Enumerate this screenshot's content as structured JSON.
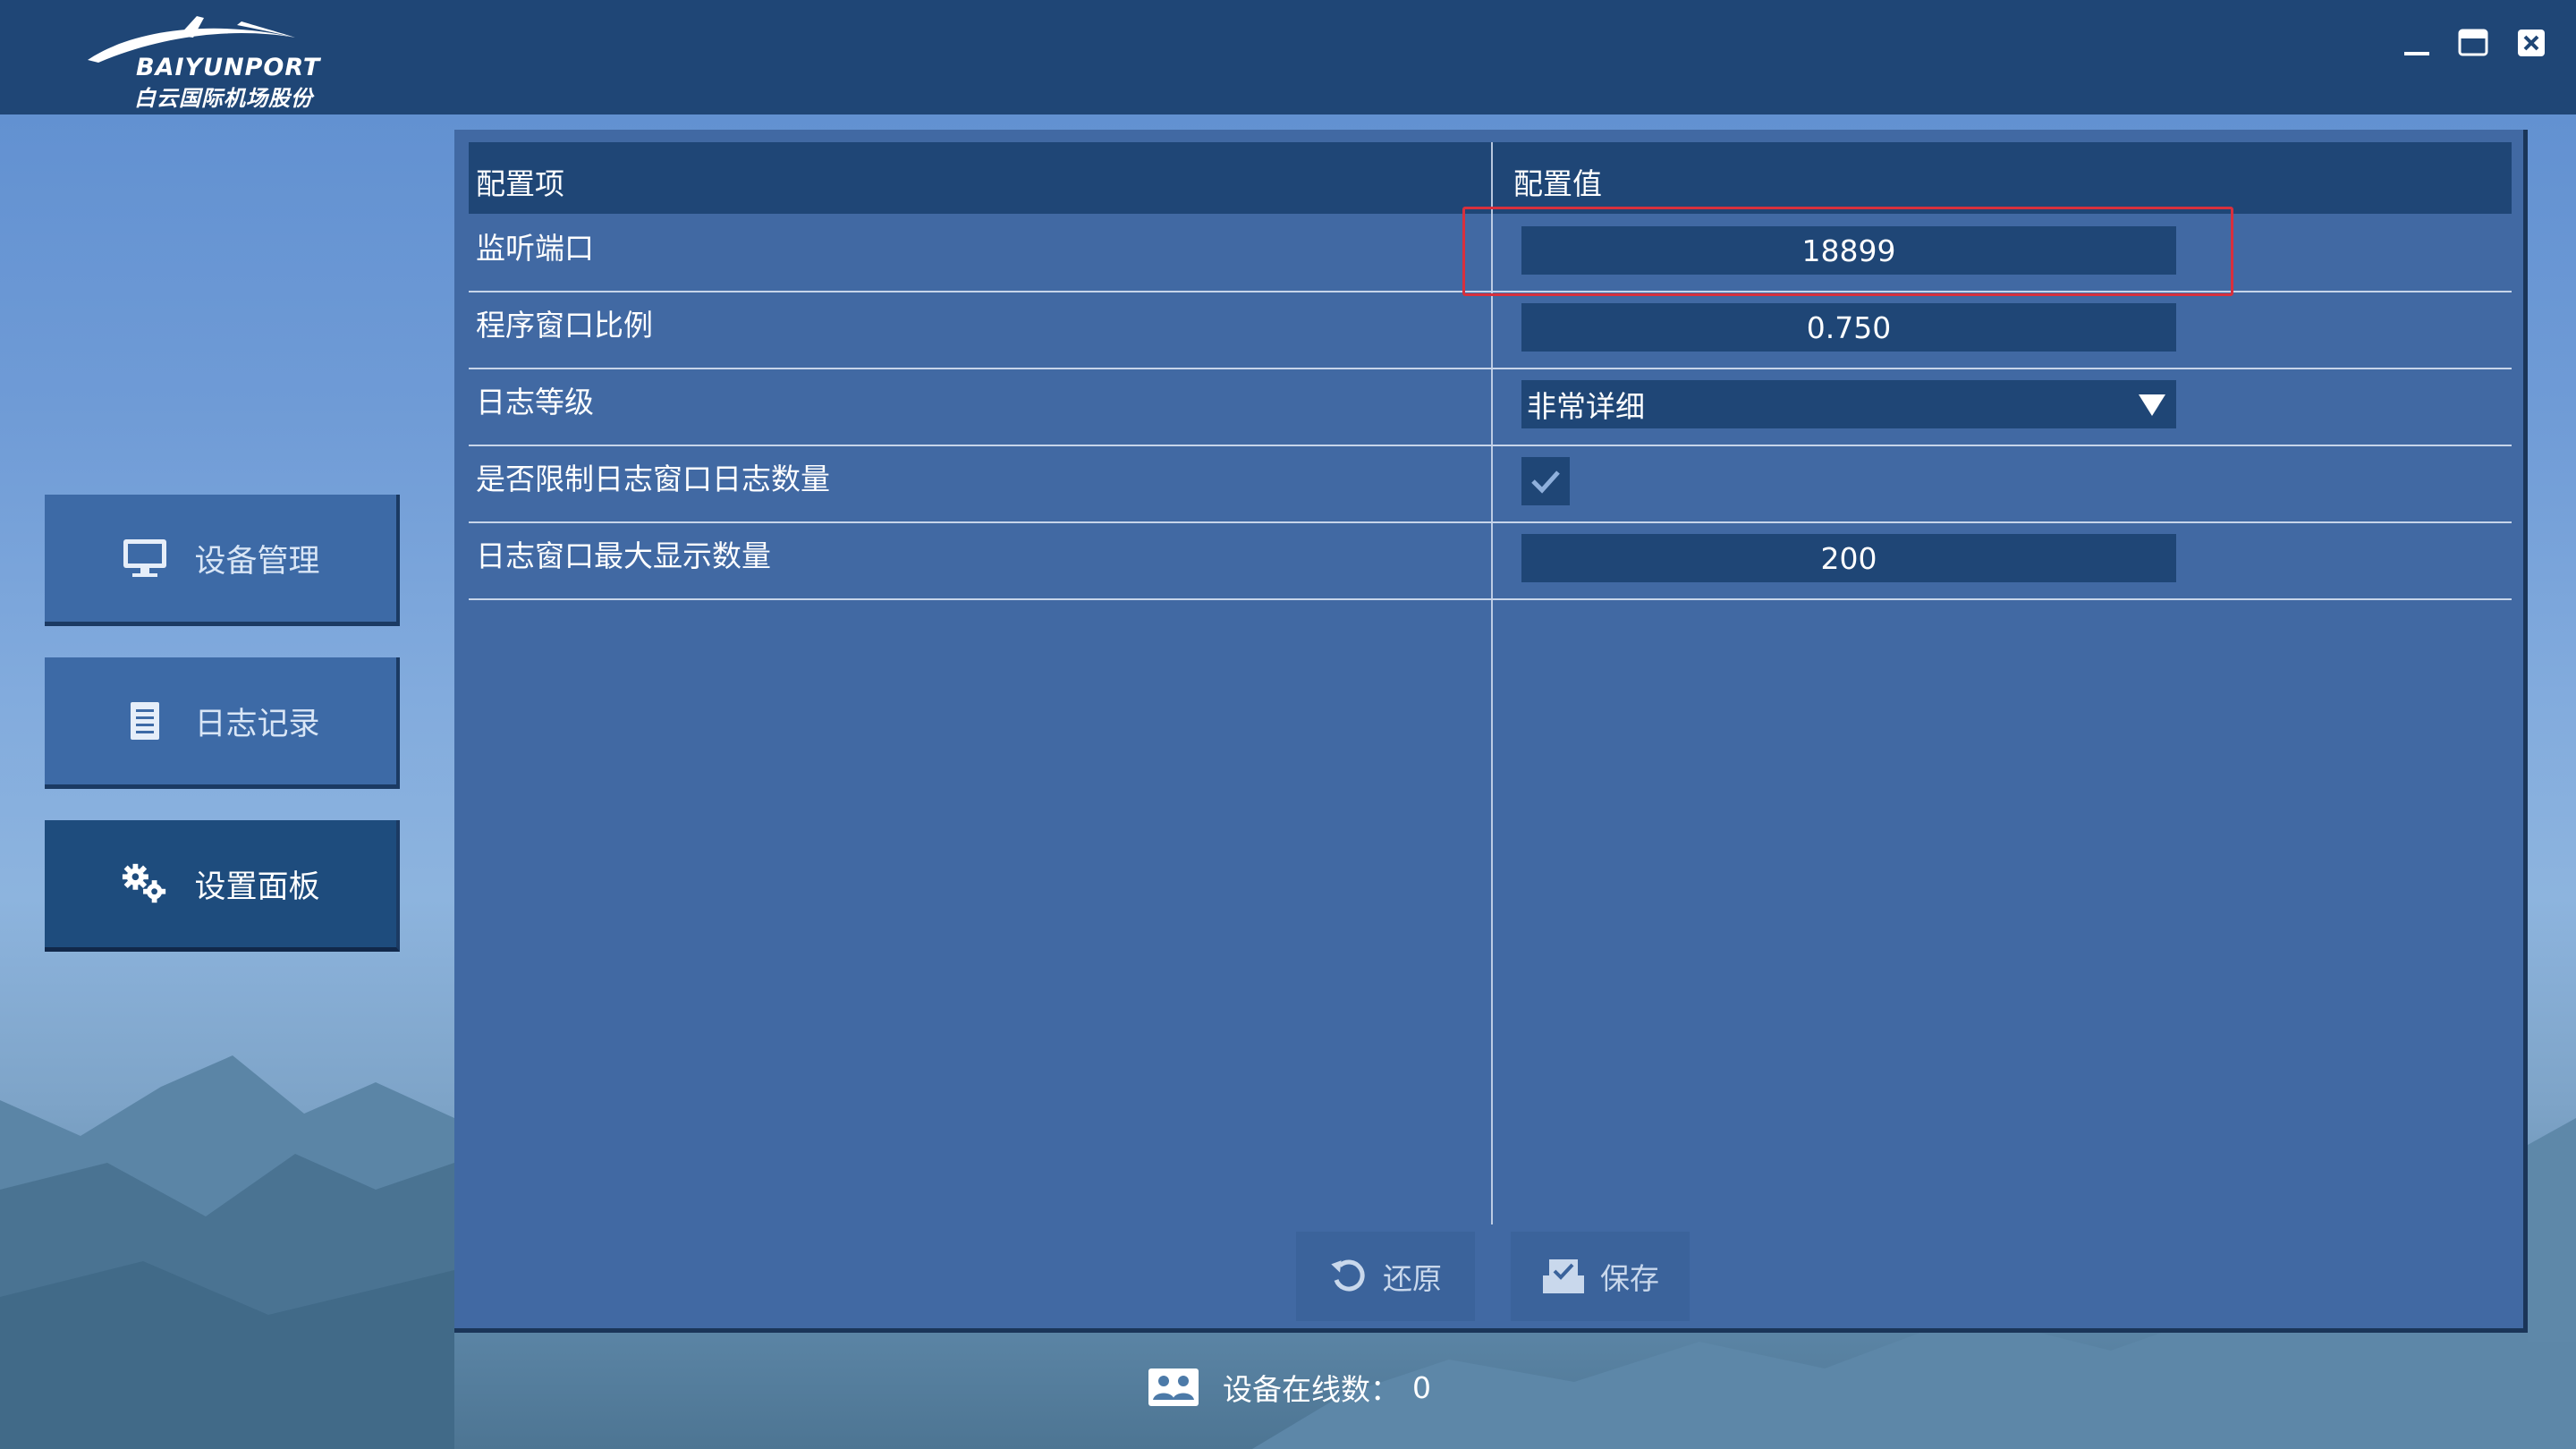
{
  "app": {
    "logo_en": "BAIYUNPORT",
    "logo_cn": "白云国际机场股份"
  },
  "window_controls": [
    {
      "name": "minimize",
      "icon": "minimize-icon"
    },
    {
      "name": "maximize",
      "icon": "maximize-icon"
    },
    {
      "name": "close",
      "icon": "close-icon"
    }
  ],
  "sidebar": {
    "items": [
      {
        "label": "设备管理",
        "icon": "monitor-icon",
        "active": false
      },
      {
        "label": "日志记录",
        "icon": "document-icon",
        "active": false
      },
      {
        "label": "设置面板",
        "icon": "gears-icon",
        "active": true
      }
    ]
  },
  "settings": {
    "columns": [
      "配置项",
      "配置值"
    ],
    "rows": [
      {
        "label": "监听端口",
        "type": "text",
        "value": "18899"
      },
      {
        "label": "程序窗口比例",
        "type": "text",
        "value": "0.750"
      },
      {
        "label": "日志等级",
        "type": "select",
        "value": "非常详细"
      },
      {
        "label": "是否限制日志窗口日志数量",
        "type": "checkbox",
        "checked": true
      },
      {
        "label": "日志窗口最大显示数量",
        "type": "text",
        "value": "200"
      }
    ]
  },
  "actions": {
    "restore_label": "还原",
    "save_label": "保存"
  },
  "status": {
    "label": "设备在线数：",
    "count": "0"
  },
  "colors": {
    "header": "#1f4676",
    "panel": "#4169a3",
    "field": "#1f4676",
    "highlight": "#d8303d"
  }
}
